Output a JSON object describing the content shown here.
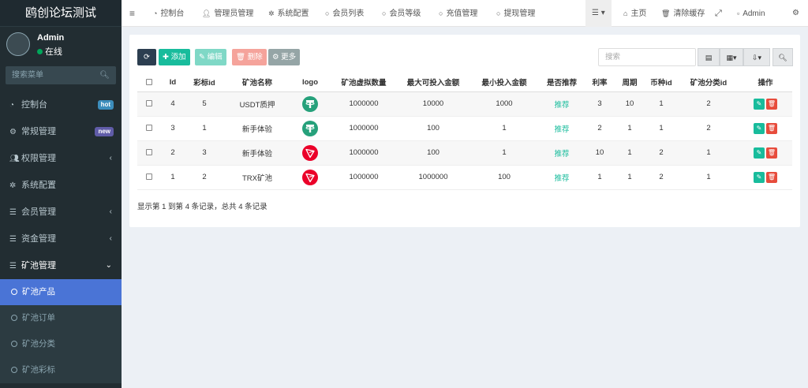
{
  "app": {
    "title": "鸥创论坛测试"
  },
  "user": {
    "name": "Admin",
    "status": "在线"
  },
  "sidebar": {
    "search_placeholder": "搜索菜单",
    "items": [
      {
        "label": "控制台",
        "icon": "dashboard-icon",
        "badge": "hot"
      },
      {
        "label": "常规管理",
        "icon": "cogs-icon",
        "badge": "new"
      },
      {
        "label": "权限管理",
        "icon": "users-icon",
        "arrow": "‹"
      },
      {
        "label": "系统配置",
        "icon": "gear-icon"
      },
      {
        "label": "会员管理",
        "icon": "list-icon",
        "arrow": "‹"
      },
      {
        "label": "资金管理",
        "icon": "list-icon",
        "arrow": "‹"
      },
      {
        "label": "矿池管理",
        "icon": "list-icon",
        "arrow": "⌄"
      }
    ],
    "subitems": [
      {
        "label": "矿池产品",
        "active": true
      },
      {
        "label": "矿池订单"
      },
      {
        "label": "矿池分类"
      },
      {
        "label": "矿池彩标"
      }
    ]
  },
  "topnav": {
    "items": [
      {
        "label": "控制台",
        "icon": "dashboard-icon"
      },
      {
        "label": "管理员管理",
        "icon": "user-icon"
      },
      {
        "label": "系统配置",
        "icon": "gear-icon"
      },
      {
        "label": "会员列表",
        "icon": "circle-icon"
      },
      {
        "label": "会员等级",
        "icon": "circle-icon"
      },
      {
        "label": "充值管理",
        "icon": "circle-icon"
      },
      {
        "label": "提现管理",
        "icon": "circle-icon"
      }
    ],
    "home_label": "主页",
    "clear_cache_label": "清除缓存",
    "admin_label": "Admin"
  },
  "toolbar": {
    "add_label": "添加",
    "edit_label": "编辑",
    "delete_label": "删除",
    "more_label": "更多",
    "search_placeholder": "搜索"
  },
  "table": {
    "columns": [
      "Id",
      "彩标id",
      "矿池名称",
      "logo",
      "矿池虚拟数量",
      "最大可投入金额",
      "最小投入金额",
      "是否推荐",
      "利率",
      "周期",
      "币种id",
      "矿池分类id",
      "操作"
    ],
    "rows": [
      {
        "id": "4",
        "tag_id": "5",
        "name": "USDT质押",
        "logo": "usdt",
        "virtual": "1000000",
        "max": "10000",
        "min": "1000",
        "recommend": "推荐",
        "rate": "3",
        "cycle": "10",
        "coin_id": "1",
        "cat_id": "2"
      },
      {
        "id": "3",
        "tag_id": "1",
        "name": "新手体验",
        "logo": "usdt",
        "virtual": "1000000",
        "max": "100",
        "min": "1",
        "recommend": "推荐",
        "rate": "2",
        "cycle": "1",
        "coin_id": "1",
        "cat_id": "2"
      },
      {
        "id": "2",
        "tag_id": "3",
        "name": "新手体验",
        "logo": "trx",
        "virtual": "1000000",
        "max": "100",
        "min": "1",
        "recommend": "推荐",
        "rate": "10",
        "cycle": "1",
        "coin_id": "2",
        "cat_id": "1"
      },
      {
        "id": "1",
        "tag_id": "2",
        "name": "TRX矿池",
        "logo": "trx",
        "virtual": "1000000",
        "max": "1000000",
        "min": "100",
        "recommend": "推荐",
        "rate": "1",
        "cycle": "1",
        "coin_id": "2",
        "cat_id": "1"
      }
    ],
    "footer": "显示第 1 到第 4 条记录，总共 4 条记录"
  },
  "colors": {
    "primary": "#18bc9c",
    "danger": "#e74c3c",
    "sidebar_bg": "#222d32",
    "active": "#4a74d6",
    "usdt": "#26a17b",
    "trx": "#eb0029"
  }
}
